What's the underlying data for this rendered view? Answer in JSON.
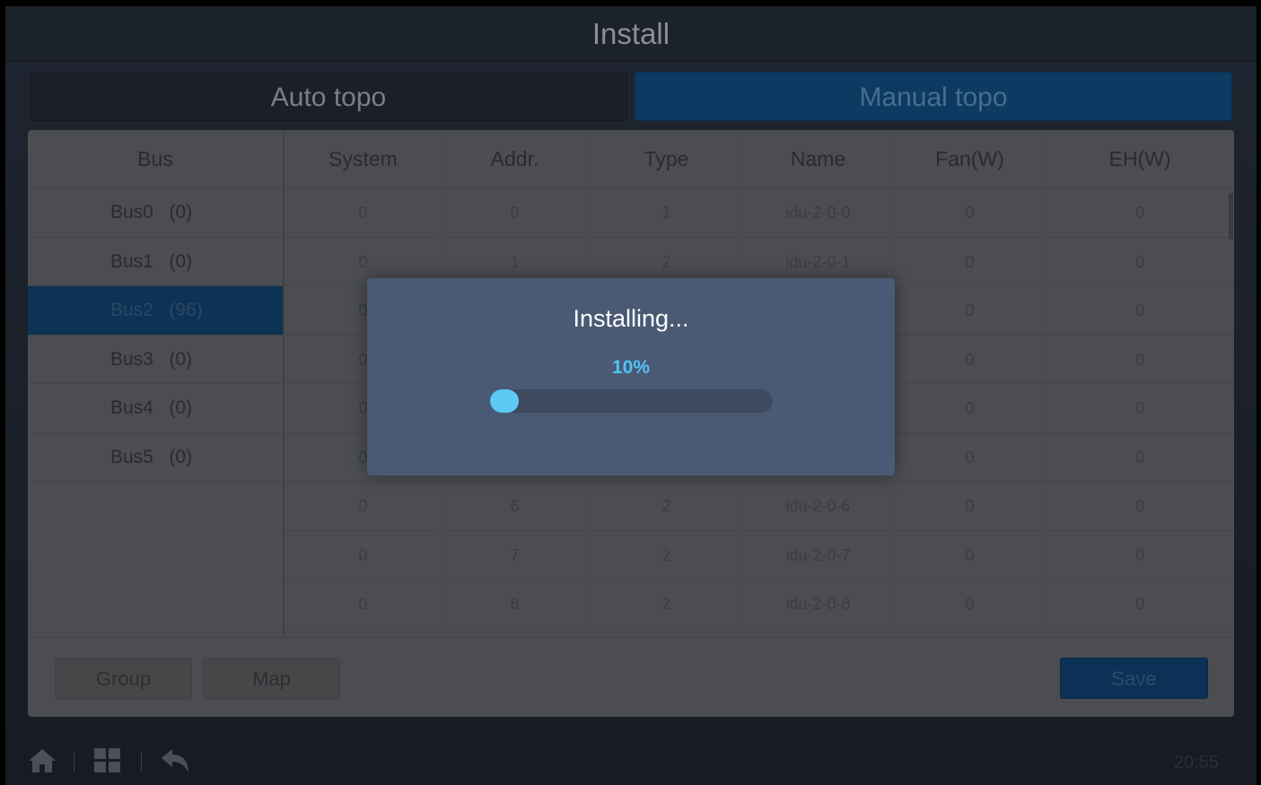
{
  "header": {
    "title": "Install"
  },
  "tabs": [
    {
      "label": "Auto topo",
      "active": false
    },
    {
      "label": "Manual topo",
      "active": true
    }
  ],
  "buses": {
    "header": "Bus",
    "items": [
      {
        "name": "Bus0",
        "count": "(0)",
        "selected": false
      },
      {
        "name": "Bus1",
        "count": "(0)",
        "selected": false
      },
      {
        "name": "Bus2",
        "count": "(96)",
        "selected": true
      },
      {
        "name": "Bus3",
        "count": "(0)",
        "selected": false
      },
      {
        "name": "Bus4",
        "count": "(0)",
        "selected": false
      },
      {
        "name": "Bus5",
        "count": "(0)",
        "selected": false
      }
    ]
  },
  "table": {
    "columns": [
      "System",
      "Addr.",
      "Type",
      "Name",
      "Fan(W)",
      "EH(W)"
    ],
    "rows": [
      [
        "0",
        "0",
        "1",
        "idu-2-0-0",
        "0",
        "0"
      ],
      [
        "0",
        "1",
        "2",
        "idu-2-0-1",
        "0",
        "0"
      ],
      [
        "0",
        "",
        "",
        "",
        "0",
        "0"
      ],
      [
        "0",
        "",
        "",
        "",
        "0",
        "0"
      ],
      [
        "0",
        "",
        "",
        "",
        "0",
        "0"
      ],
      [
        "0",
        "",
        "",
        "",
        "0",
        "0"
      ],
      [
        "0",
        "6",
        "2",
        "idu-2-0-6",
        "0",
        "0"
      ],
      [
        "0",
        "7",
        "2",
        "idu-2-0-7",
        "0",
        "0"
      ],
      [
        "0",
        "8",
        "2",
        "idu-2-0-8",
        "0",
        "0"
      ]
    ]
  },
  "buttons": {
    "group": "Group",
    "map": "Map",
    "save": "Save"
  },
  "bottom_bar": {
    "icons": [
      "home-icon",
      "grid-icon",
      "back-icon"
    ],
    "time": "20:55"
  },
  "modal": {
    "title": "Installing...",
    "percent_label": "10%",
    "progress": 0.1,
    "color": "#5ccaf5"
  }
}
